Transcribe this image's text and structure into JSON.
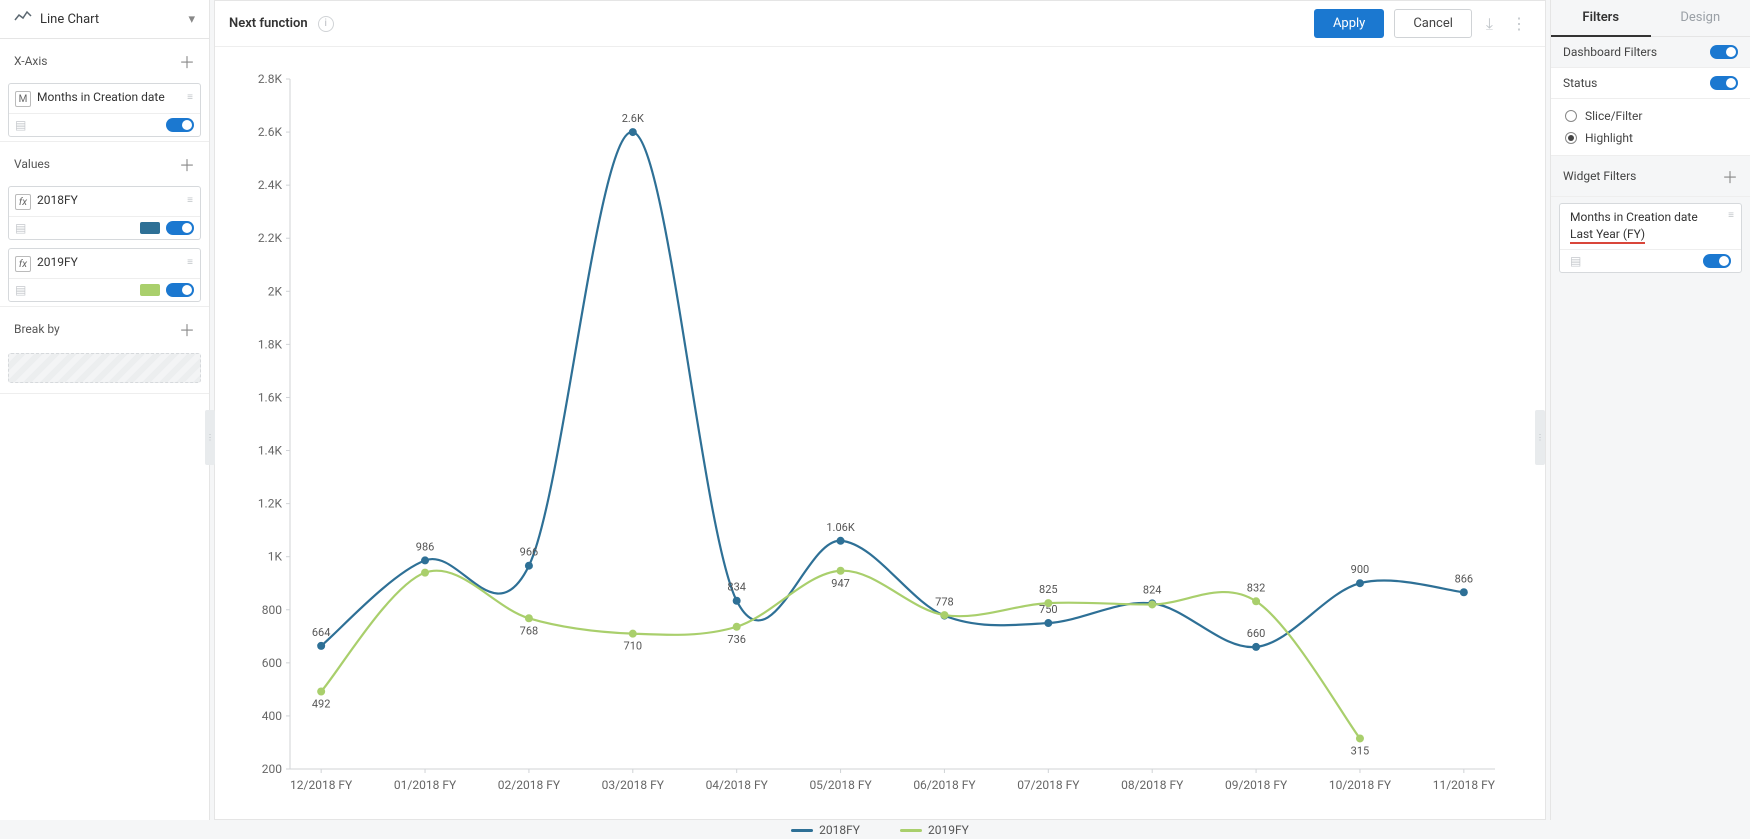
{
  "left": {
    "chartType": "Line Chart",
    "xaxis": {
      "title": "X-Axis",
      "items": [
        {
          "badge": "M",
          "label": "Months in Creation date"
        }
      ]
    },
    "values": {
      "title": "Values",
      "items": [
        {
          "badge": "fx",
          "label": "2018FY",
          "color": "#2e7096"
        },
        {
          "badge": "fx",
          "label": "2019FY",
          "color": "#a9cf6c"
        }
      ]
    },
    "breakby": {
      "title": "Break by"
    }
  },
  "header": {
    "title": "Next function",
    "apply": "Apply",
    "cancel": "Cancel"
  },
  "right": {
    "tabFilters": "Filters",
    "tabDesign": "Design",
    "dashboardFilters": "Dashboard Filters",
    "status": "Status",
    "sliceFilter": "Slice/Filter",
    "highlight": "Highlight",
    "widgetFilters": "Widget Filters",
    "wfLabel": "Months in Creation date",
    "wfValue": "Last Year (FY)"
  },
  "chart_data": {
    "type": "line",
    "categories": [
      "12/2018 FY",
      "01/2018 FY",
      "02/2018 FY",
      "03/2018 FY",
      "04/2018 FY",
      "05/2018 FY",
      "06/2018 FY",
      "07/2018 FY",
      "08/2018 FY",
      "09/2018 FY",
      "10/2018 FY",
      "11/2018 FY"
    ],
    "series": [
      {
        "name": "2018FY",
        "color": "#2e7096",
        "values": [
          664,
          986,
          966,
          2600,
          834,
          1060,
          778,
          750,
          824,
          660,
          900,
          866
        ],
        "labels": [
          "664",
          "986",
          "966",
          "2.6K",
          "834",
          "1.06K",
          "778",
          "750",
          "824",
          "660",
          "900",
          "866"
        ]
      },
      {
        "name": "2019FY",
        "color": "#a9cf6c",
        "values": [
          492,
          940,
          768,
          710,
          736,
          947,
          780,
          825,
          820,
          832,
          315,
          null
        ],
        "labels": [
          "492",
          "",
          "768",
          "710",
          "736",
          "947",
          "",
          "825",
          "",
          "832",
          "315",
          ""
        ]
      }
    ],
    "ylim": [
      200,
      2800
    ],
    "yticks": [
      200,
      400,
      600,
      800,
      1000,
      1200,
      1400,
      1600,
      1800,
      2000,
      2200,
      2400,
      2600,
      2800
    ],
    "yticklabels": [
      "200",
      "400",
      "600",
      "800",
      "1K",
      "1.2K",
      "1.4K",
      "1.6K",
      "1.8K",
      "2K",
      "2.2K",
      "2.4K",
      "2.6K",
      "2.8K"
    ]
  }
}
